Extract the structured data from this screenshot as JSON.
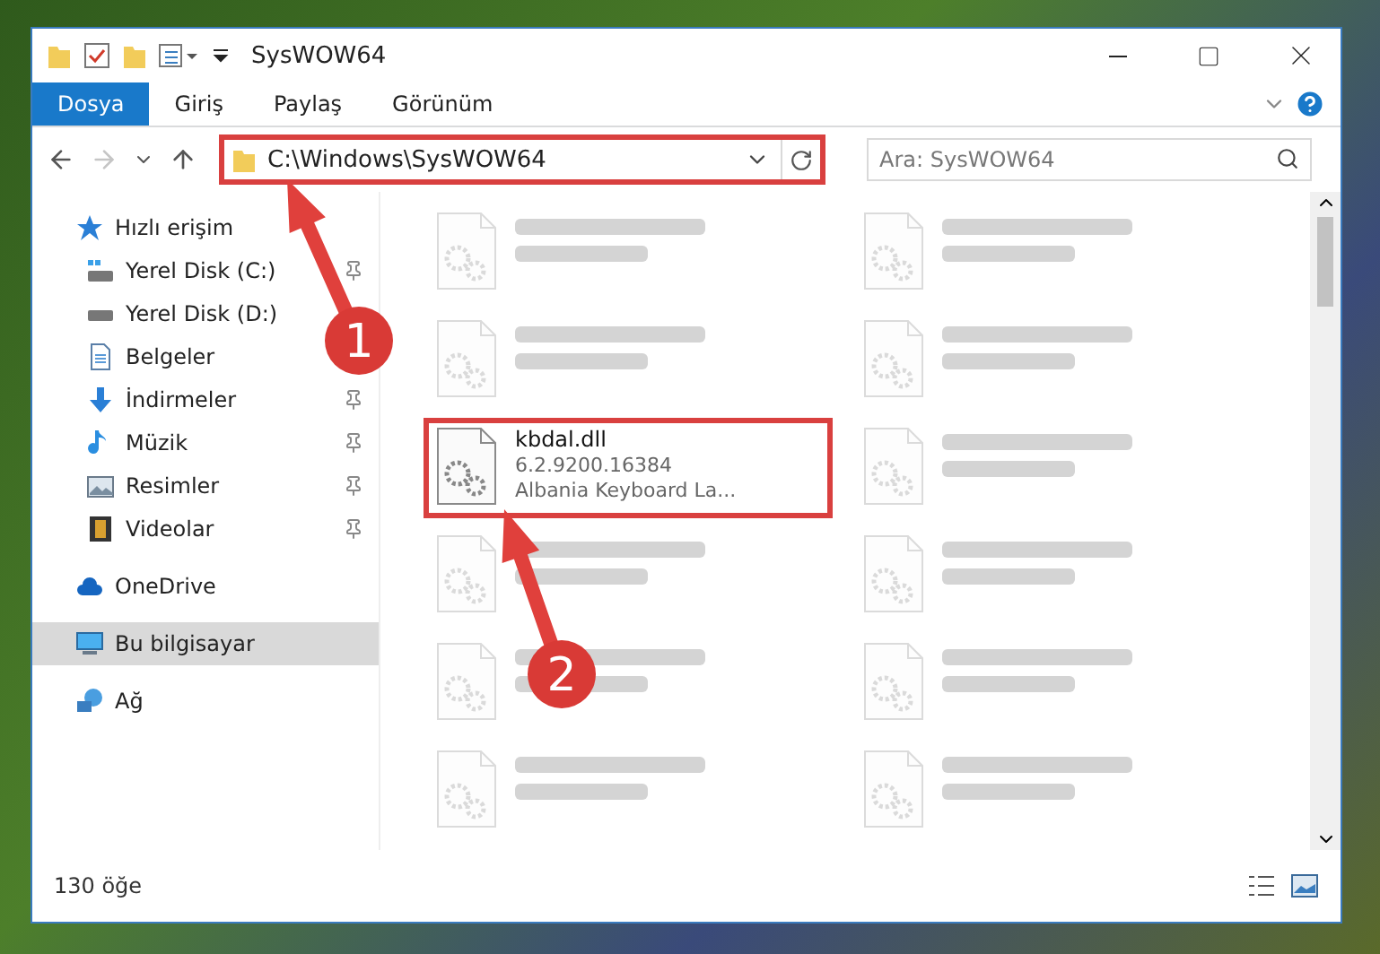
{
  "window": {
    "title": "SysWOW64"
  },
  "ribbon": {
    "tabs": [
      {
        "label": "Dosya",
        "selected": true
      },
      {
        "label": "Giriş",
        "selected": false
      },
      {
        "label": "Paylaş",
        "selected": false
      },
      {
        "label": "Görünüm",
        "selected": false
      }
    ]
  },
  "address_bar": {
    "path": "C:\\Windows\\SysWOW64",
    "highlighted": true,
    "forward_disabled": true
  },
  "search": {
    "placeholder": "Ara: SysWOW64"
  },
  "sidebar": {
    "items": [
      {
        "label": "Hızlı erişim",
        "selected": false,
        "children": [
          {
            "label": "Yerel Disk (C:)",
            "pinned": true,
            "selected": false
          },
          {
            "label": "Yerel Disk (D:)",
            "pinned": false,
            "selected": false
          },
          {
            "label": "Belgeler",
            "pinned": false,
            "selected": false
          },
          {
            "label": "İndirmeler",
            "pinned": true,
            "selected": false
          },
          {
            "label": "Müzik",
            "pinned": true,
            "selected": false
          },
          {
            "label": "Resimler",
            "pinned": true,
            "selected": false
          },
          {
            "label": "Videolar",
            "pinned": true,
            "selected": false
          }
        ]
      },
      {
        "label": "OneDrive",
        "selected": false
      },
      {
        "label": "Bu bilgisayar",
        "selected": true
      },
      {
        "label": "Ağ",
        "selected": false
      }
    ]
  },
  "files": [
    {
      "blurred": true,
      "highlighted": false
    },
    {
      "blurred": true,
      "highlighted": false
    },
    {
      "blurred": true,
      "highlighted": false
    },
    {
      "blurred": true,
      "highlighted": false
    },
    {
      "name": "kbdal.dll",
      "lines": [
        "6.2.9200.16384",
        "Albania Keyboard La..."
      ],
      "blurred": false,
      "highlighted": true
    },
    {
      "blurred": true,
      "highlighted": false
    },
    {
      "blurred": true,
      "highlighted": false
    },
    {
      "blurred": true,
      "highlighted": false
    },
    {
      "blurred": true,
      "highlighted": false
    },
    {
      "blurred": true,
      "highlighted": false
    },
    {
      "blurred": true,
      "highlighted": false
    },
    {
      "blurred": true,
      "highlighted": false
    }
  ],
  "status_bar": {
    "count": "130 öğe"
  },
  "annotations": [
    {
      "number": "1"
    },
    {
      "number": "2"
    }
  ]
}
